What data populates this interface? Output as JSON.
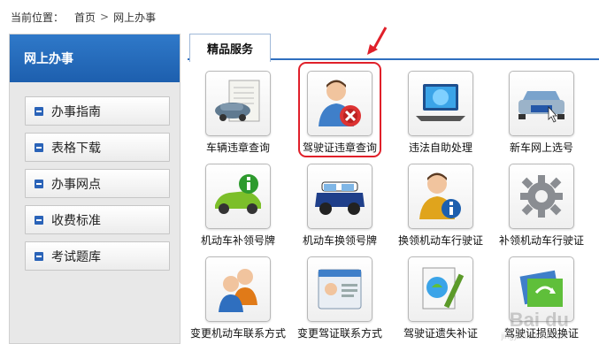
{
  "breadcrumb": {
    "prefix": "当前位置：",
    "home": "首页",
    "separator": ">",
    "current": "网上办事"
  },
  "sidebar": {
    "title": "网上办事",
    "items": [
      {
        "label": "办事指南"
      },
      {
        "label": "表格下载"
      },
      {
        "label": "办事网点"
      },
      {
        "label": "收费标准"
      },
      {
        "label": "考试题库"
      }
    ]
  },
  "main": {
    "tab": "精品服务",
    "services": [
      {
        "label": "车辆违章查询",
        "icon": "car-violation-query-icon"
      },
      {
        "label": "驾驶证违章查询",
        "icon": "license-violation-query-icon"
      },
      {
        "label": "违法自助处理",
        "icon": "laptop-self-service-icon"
      },
      {
        "label": "新车网上选号",
        "icon": "new-car-plate-select-icon"
      },
      {
        "label": "机动车补领号牌",
        "icon": "green-car-info-icon"
      },
      {
        "label": "机动车换领号牌",
        "icon": "mini-car-icon"
      },
      {
        "label": "换领机动车行驶证",
        "icon": "person-info-icon"
      },
      {
        "label": "补领机动车行驶证",
        "icon": "gear-icon"
      },
      {
        "label": "变更机动车联系方式",
        "icon": "people-group-icon"
      },
      {
        "label": "变更驾证联系方式",
        "icon": "id-card-icon"
      },
      {
        "label": "驾驶证遗失补证",
        "icon": "document-pen-icon"
      },
      {
        "label": "驾驶证损毁换证",
        "icon": "folder-refresh-icon"
      }
    ]
  },
  "watermark": {
    "text": "Bai du",
    "sub": "jingyan.baidu.com"
  },
  "colors": {
    "accent": "#2f6fbf",
    "highlight": "#e0202a"
  }
}
